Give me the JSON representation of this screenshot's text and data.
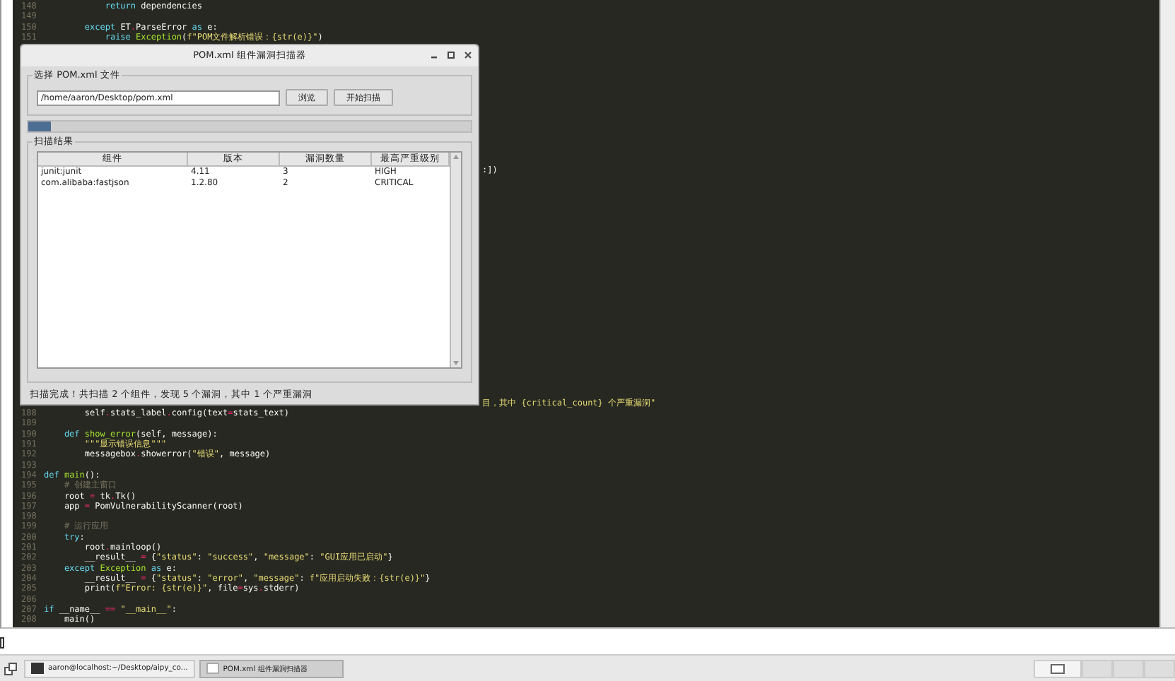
{
  "editor": {
    "lines_top": [
      {
        "number": "148",
        "tokens": [
          {
            "text": "            return",
            "kind": "keyword"
          },
          {
            "text": " dependencies",
            "kind": "plain"
          }
        ]
      },
      {
        "number": "149"
      },
      {
        "number": "150",
        "tokens": [
          {
            "text": "        except",
            "kind": "keyword"
          },
          {
            "text": " ET",
            "kind": "plain"
          },
          {
            "text": ".",
            "kind": "operator"
          },
          {
            "text": "ParseError ",
            "kind": "plain"
          },
          {
            "text": "as",
            "kind": "keyword"
          },
          {
            "text": " e:",
            "kind": "plain"
          }
        ]
      },
      {
        "number": "151",
        "tokens": [
          {
            "text": "            raise",
            "kind": "keyword"
          },
          {
            "text": " Exception",
            "kind": "function"
          },
          {
            "text": "(",
            "kind": "plain"
          },
          {
            "text": "f\"POM文件解析错误：{str(e)}\"",
            "kind": "string"
          },
          {
            "text": ")",
            "kind": "plain"
          }
        ]
      }
    ],
    "fragments": [
      {
        "tokens": [
          {
            "text": ":])",
            "kind": "plain"
          }
        ]
      },
      {
        "tokens": [
          {
            "text": "目，其中 {critical_count} 个严重漏洞\"",
            "kind": "string"
          }
        ]
      }
    ],
    "lines_bottom": [
      {
        "number": "188",
        "tokens": [
          {
            "text": "        self",
            "kind": "plain"
          },
          {
            "text": ".",
            "kind": "operator"
          },
          {
            "text": "stats_label",
            "kind": "plain"
          },
          {
            "text": ".",
            "kind": "operator"
          },
          {
            "text": "config(text",
            "kind": "plain"
          },
          {
            "text": "=",
            "kind": "operator"
          },
          {
            "text": "stats_text)",
            "kind": "plain"
          }
        ]
      },
      {
        "number": "189"
      },
      {
        "number": "190",
        "tokens": [
          {
            "text": "    def",
            "kind": "keyword"
          },
          {
            "text": " show_error",
            "kind": "function"
          },
          {
            "text": "(self, message):",
            "kind": "plain"
          }
        ]
      },
      {
        "number": "191",
        "tokens": [
          {
            "text": "        \"\"\"显示错误信息\"\"\"",
            "kind": "string"
          }
        ]
      },
      {
        "number": "192",
        "tokens": [
          {
            "text": "        messagebox",
            "kind": "plain"
          },
          {
            "text": ".",
            "kind": "operator"
          },
          {
            "text": "showerror(",
            "kind": "plain"
          },
          {
            "text": "\"错误\"",
            "kind": "string"
          },
          {
            "text": ", message)",
            "kind": "plain"
          }
        ]
      },
      {
        "number": "193"
      },
      {
        "number": "194",
        "tokens": [
          {
            "text": "def",
            "kind": "keyword"
          },
          {
            "text": " main",
            "kind": "function"
          },
          {
            "text": "():",
            "kind": "plain"
          }
        ]
      },
      {
        "number": "195",
        "tokens": [
          {
            "text": "    # 创建主窗口",
            "kind": "comment"
          }
        ]
      },
      {
        "number": "196",
        "tokens": [
          {
            "text": "    root ",
            "kind": "plain"
          },
          {
            "text": "=",
            "kind": "operator"
          },
          {
            "text": " tk",
            "kind": "plain"
          },
          {
            "text": ".",
            "kind": "operator"
          },
          {
            "text": "Tk()",
            "kind": "plain"
          }
        ]
      },
      {
        "number": "197",
        "tokens": [
          {
            "text": "    app ",
            "kind": "plain"
          },
          {
            "text": "=",
            "kind": "operator"
          },
          {
            "text": " PomVulnerabilityScanner(root)",
            "kind": "plain"
          }
        ]
      },
      {
        "number": "198"
      },
      {
        "number": "199",
        "tokens": [
          {
            "text": "    # 运行应用",
            "kind": "comment"
          }
        ]
      },
      {
        "number": "200",
        "tokens": [
          {
            "text": "    try",
            "kind": "keyword"
          },
          {
            "text": ":",
            "kind": "plain"
          }
        ]
      },
      {
        "number": "201",
        "tokens": [
          {
            "text": "        root",
            "kind": "plain"
          },
          {
            "text": ".",
            "kind": "operator"
          },
          {
            "text": "mainloop()",
            "kind": "plain"
          }
        ]
      },
      {
        "number": "202",
        "tokens": [
          {
            "text": "        __result__ ",
            "kind": "plain"
          },
          {
            "text": "=",
            "kind": "operator"
          },
          {
            "text": " {",
            "kind": "plain"
          },
          {
            "text": "\"status\"",
            "kind": "string"
          },
          {
            "text": ": ",
            "kind": "plain"
          },
          {
            "text": "\"success\"",
            "kind": "string"
          },
          {
            "text": ", ",
            "kind": "plain"
          },
          {
            "text": "\"message\"",
            "kind": "string"
          },
          {
            "text": ": ",
            "kind": "plain"
          },
          {
            "text": "\"GUI应用已启动\"",
            "kind": "string"
          },
          {
            "text": "}",
            "kind": "plain"
          }
        ]
      },
      {
        "number": "203",
        "tokens": [
          {
            "text": "    except",
            "kind": "keyword"
          },
          {
            "text": " Exception",
            "kind": "function"
          },
          {
            "text": " as",
            "kind": "keyword"
          },
          {
            "text": " e:",
            "kind": "plain"
          }
        ]
      },
      {
        "number": "204",
        "tokens": [
          {
            "text": "        __result__ ",
            "kind": "plain"
          },
          {
            "text": "=",
            "kind": "operator"
          },
          {
            "text": " {",
            "kind": "plain"
          },
          {
            "text": "\"status\"",
            "kind": "string"
          },
          {
            "text": ": ",
            "kind": "plain"
          },
          {
            "text": "\"error\"",
            "kind": "string"
          },
          {
            "text": ", ",
            "kind": "plain"
          },
          {
            "text": "\"message\"",
            "kind": "string"
          },
          {
            "text": ": ",
            "kind": "plain"
          },
          {
            "text": "f\"应用启动失败：{str(e)}\"",
            "kind": "string"
          },
          {
            "text": "}",
            "kind": "plain"
          }
        ]
      },
      {
        "number": "205",
        "tokens": [
          {
            "text": "        print(",
            "kind": "plain"
          },
          {
            "text": "f\"Error: {str(e)}\"",
            "kind": "string"
          },
          {
            "text": ", file",
            "kind": "plain"
          },
          {
            "text": "=",
            "kind": "operator"
          },
          {
            "text": "sys",
            "kind": "plain"
          },
          {
            "text": ".",
            "kind": "operator"
          },
          {
            "text": "stderr)",
            "kind": "plain"
          }
        ]
      },
      {
        "number": "206"
      },
      {
        "number": "207",
        "tokens": [
          {
            "text": "if",
            "kind": "keyword"
          },
          {
            "text": " __name__ ",
            "kind": "plain"
          },
          {
            "text": "==",
            "kind": "operator"
          },
          {
            "text": " \"__main__\"",
            "kind": "string"
          },
          {
            "text": ":",
            "kind": "plain"
          }
        ]
      },
      {
        "number": "208",
        "tokens": [
          {
            "text": "    main()",
            "kind": "plain"
          }
        ]
      }
    ]
  },
  "dialog": {
    "title": "POM.xml 组件漏洞扫描器",
    "file_group": {
      "label": "选择 POM.xml 文件",
      "path": "/home/aaron/Desktop/pom.xml",
      "buttons": [
        "浏览",
        "开始扫描"
      ]
    },
    "progress": {
      "level": 0.05
    },
    "results_group": {
      "label": "扫描结果",
      "columns": [
        "组件",
        "版本",
        "漏洞数量",
        "最高严重级别"
      ],
      "rows": [
        {
          "cells": [
            "junit:junit",
            "4.11",
            "3",
            "HIGH"
          ],
          "selected": false
        },
        {
          "cells": [
            "com.alibaba:fastjson",
            "1.2.80",
            "2",
            "CRITICAL"
          ],
          "selected": false
        }
      ]
    },
    "status": "扫描完成！共扫描 2 个组件，发现 5 个漏洞，其中 1 个严重漏洞"
  },
  "taskbar": {
    "tasks": [
      {
        "label": "aaron@localhost:~/Desktop/aipy_co...",
        "kind": "terminal",
        "selected": false
      },
      {
        "label": "POM.xml 组件漏洞扫描器",
        "kind": "window",
        "selected": true
      }
    ]
  }
}
